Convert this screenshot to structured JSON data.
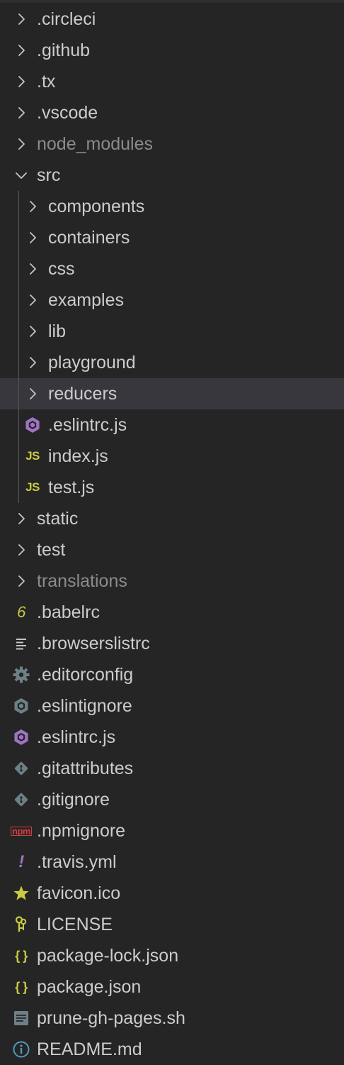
{
  "explorer": {
    "items": [
      {
        "label": ".circleci",
        "type": "folder",
        "icon": "chevron-right-icon",
        "depth": 0
      },
      {
        "label": ".github",
        "type": "folder",
        "icon": "chevron-right-icon",
        "depth": 0
      },
      {
        "label": ".tx",
        "type": "folder",
        "icon": "chevron-right-icon",
        "depth": 0
      },
      {
        "label": ".vscode",
        "type": "folder",
        "icon": "chevron-right-icon",
        "depth": 0
      },
      {
        "label": "node_modules",
        "type": "folder",
        "icon": "chevron-right-icon",
        "depth": 0,
        "dimmed": true
      },
      {
        "label": "src",
        "type": "folder",
        "icon": "chevron-down-icon",
        "depth": 0,
        "expanded": true
      },
      {
        "label": "components",
        "type": "folder",
        "icon": "chevron-right-icon",
        "depth": 1
      },
      {
        "label": "containers",
        "type": "folder",
        "icon": "chevron-right-icon",
        "depth": 1
      },
      {
        "label": "css",
        "type": "folder",
        "icon": "chevron-right-icon",
        "depth": 1
      },
      {
        "label": "examples",
        "type": "folder",
        "icon": "chevron-right-icon",
        "depth": 1
      },
      {
        "label": "lib",
        "type": "folder",
        "icon": "chevron-right-icon",
        "depth": 1
      },
      {
        "label": "playground",
        "type": "folder",
        "icon": "chevron-right-icon",
        "depth": 1
      },
      {
        "label": "reducers",
        "type": "folder",
        "icon": "chevron-right-icon",
        "depth": 1,
        "selected": true
      },
      {
        "label": ".eslintrc.js",
        "type": "file",
        "icon": "eslint-icon",
        "depth": 1
      },
      {
        "label": "index.js",
        "type": "file",
        "icon": "javascript-icon",
        "icon_text": "JS",
        "depth": 1
      },
      {
        "label": "test.js",
        "type": "file",
        "icon": "javascript-icon",
        "icon_text": "JS",
        "depth": 1
      },
      {
        "label": "static",
        "type": "folder",
        "icon": "chevron-right-icon",
        "depth": 0
      },
      {
        "label": "test",
        "type": "folder",
        "icon": "chevron-right-icon",
        "depth": 0
      },
      {
        "label": "translations",
        "type": "folder",
        "icon": "chevron-right-icon",
        "depth": 0,
        "dimmed": true
      },
      {
        "label": ".babelrc",
        "type": "file",
        "icon": "babel-icon",
        "icon_text": "6",
        "depth": 0
      },
      {
        "label": ".browserslistrc",
        "type": "file",
        "icon": "lines-icon",
        "depth": 0
      },
      {
        "label": ".editorconfig",
        "type": "file",
        "icon": "gear-icon",
        "depth": 0
      },
      {
        "label": ".eslintignore",
        "type": "file",
        "icon": "eslint-ignore-icon",
        "depth": 0
      },
      {
        "label": ".eslintrc.js",
        "type": "file",
        "icon": "eslint-icon",
        "depth": 0
      },
      {
        "label": ".gitattributes",
        "type": "file",
        "icon": "git-icon",
        "depth": 0
      },
      {
        "label": ".gitignore",
        "type": "file",
        "icon": "git-icon",
        "depth": 0
      },
      {
        "label": ".npmignore",
        "type": "file",
        "icon": "npm-icon",
        "icon_text": "npm",
        "depth": 0
      },
      {
        "label": ".travis.yml",
        "type": "file",
        "icon": "yaml-icon",
        "icon_text": "!",
        "depth": 0
      },
      {
        "label": "favicon.ico",
        "type": "file",
        "icon": "star-icon",
        "depth": 0
      },
      {
        "label": "LICENSE",
        "type": "file",
        "icon": "license-icon",
        "depth": 0
      },
      {
        "label": "package-lock.json",
        "type": "file",
        "icon": "json-icon",
        "icon_text": "{ }",
        "depth": 0
      },
      {
        "label": "package.json",
        "type": "file",
        "icon": "json-icon",
        "icon_text": "{ }",
        "depth": 0
      },
      {
        "label": "prune-gh-pages.sh",
        "type": "file",
        "icon": "shell-icon",
        "depth": 0
      },
      {
        "label": "README.md",
        "type": "file",
        "icon": "info-icon",
        "depth": 0
      }
    ]
  },
  "colors": {
    "background": "#252526",
    "selected_row": "#37373d",
    "text": "#cccccc",
    "dimmed_text": "#8b8b8b",
    "javascript": "#cbcb41",
    "eslint": "#a074c4",
    "json": "#cbcb41",
    "npm": "#cc3e44",
    "star": "#cbcb41",
    "license": "#cbcb41",
    "info": "#519aba",
    "gray_icon": "#6d8086"
  }
}
